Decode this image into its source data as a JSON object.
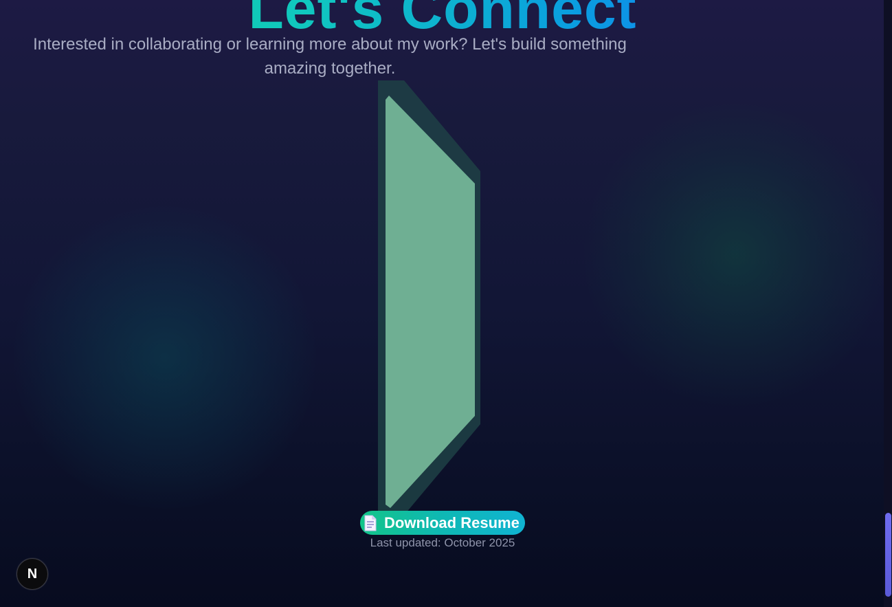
{
  "section": {
    "title": "Let's Connect",
    "subtitle": "Interested in collaborating or learning more about my work? Let's build something amazing together."
  },
  "resume": {
    "button_icon": "document-icon",
    "button_label": "Download Resume",
    "last_updated": "Last updated: October 2025"
  },
  "dev_badge": {
    "label": "N",
    "icon": "nextjs-icon"
  },
  "colors": {
    "title_gradient_start": "#13d39b",
    "title_gradient_end": "#1a6bff",
    "accent_green": "#13c489",
    "accent_teal": "#10b3d2",
    "scroll_thumb": "#6f6cf0",
    "shape_fill": "#6faf93"
  }
}
